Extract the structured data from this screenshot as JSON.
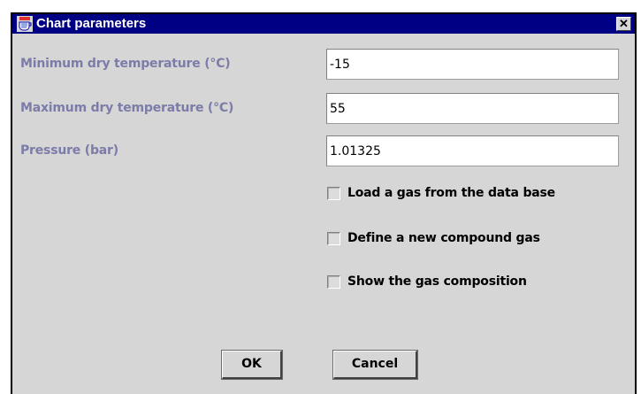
{
  "window": {
    "title": "Chart parameters",
    "close_glyph": "✕",
    "app_icon": "java-cup-icon"
  },
  "fields": [
    {
      "label": "Minimum dry temperature (°C)",
      "value": "-15"
    },
    {
      "label": "Maximum dry temperature (°C)",
      "value": "55"
    },
    {
      "label": "Pressure (bar)",
      "value": "1.01325"
    }
  ],
  "options": [
    {
      "label": "Load a gas from the data base",
      "checked": false
    },
    {
      "label": "Define a new compound gas",
      "checked": false
    },
    {
      "label": "Show the gas composition",
      "checked": false
    }
  ],
  "buttons": {
    "ok_label": "OK",
    "cancel_label": "Cancel"
  },
  "colors": {
    "titlebar": "#000084",
    "label_text": "#7c7ca8",
    "panel": "#d6d6d6"
  }
}
